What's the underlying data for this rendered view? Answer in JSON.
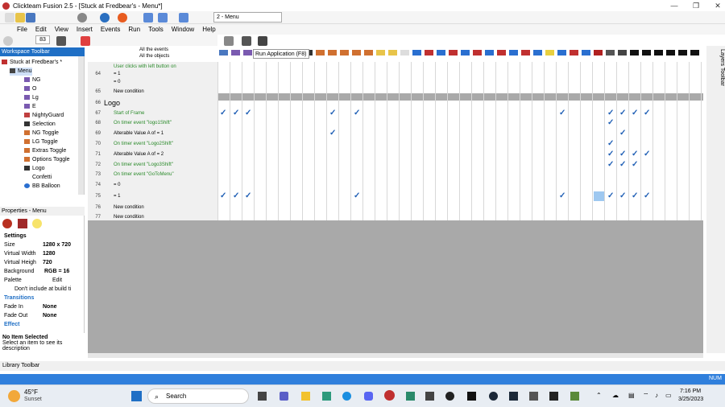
{
  "window": {
    "title": "Clickteam Fusion 2.5 - [Stuck at Fredbear's - Menu*]"
  },
  "toolbar": {
    "frame_select": "2 - Menu",
    "zoom": "83"
  },
  "menu": [
    "File",
    "Edit",
    "View",
    "Insert",
    "Events",
    "Run",
    "Tools",
    "Window",
    "Help"
  ],
  "tooltip": "Run Application (F8)",
  "workspace": {
    "header": "Workspace Toolbar",
    "items": [
      "Stuck at Fredbear's *",
      "Menu",
      "NG",
      "O",
      "Lg",
      "E",
      "NightyGuard",
      "Selection",
      "NG Toggle",
      "LG Toggle",
      "Extras Toggle",
      "Options Toggle",
      "Logo",
      "Confetti",
      "BB Balloon"
    ]
  },
  "properties": {
    "header": "Properties - Menu",
    "section_settings": "Settings",
    "size_label": "Size",
    "size_value": "1280 x 720",
    "vwidth_label": "Virtual Width",
    "vwidth_value": "1280",
    "vheight_label": "Virtual Heigh",
    "vheight_value": "720",
    "bg_label": "Background",
    "bg_value": "RGB = 16",
    "palette_label": "Palette",
    "palette_value": "Edit",
    "dont_include": "Don't include at build ti",
    "section_transitions": "Transitions",
    "fadein_label": "Fade In",
    "fadein_value": "None",
    "fadeout_label": "Fade Out",
    "fadeout_value": "None",
    "section_effect": "Effect"
  },
  "no_item": {
    "title": "No Item Selected",
    "text": "Select an item to see its description"
  },
  "library_bar": "Library Toolbar",
  "events_header": {
    "all_events": "All the events",
    "all_objects": "All the objects"
  },
  "events": [
    {
      "n": "",
      "text": "User clicks with left button on",
      "green": true
    },
    {
      "n": "64",
      "text": "= 1",
      "green": false
    },
    {
      "n": "",
      "text": "= 0",
      "green": false
    },
    {
      "n": "65",
      "text": "New condition",
      "green": false
    },
    {
      "n": "66",
      "text": "Logo",
      "green": false
    },
    {
      "n": "67",
      "text": "Start of Frame",
      "green": true
    },
    {
      "n": "68",
      "text": "On timer event \"logo1Shift\"",
      "green": true
    },
    {
      "n": "69",
      "text": "Alterable Value A of  = 1",
      "green": false
    },
    {
      "n": "70",
      "text": "On timer event \"Logo2Shift\"",
      "green": true
    },
    {
      "n": "71",
      "text": "Alterable Value A of  = 2",
      "green": false
    },
    {
      "n": "72",
      "text": "On timer event \"Logo3Shift\"",
      "green": true
    },
    {
      "n": "73",
      "text": "On timer event \"GoToMenu\"",
      "green": true
    },
    {
      "n": "74",
      "text": "= 0",
      "green": false
    },
    {
      "n": "75",
      "text": "= 1",
      "green": false
    },
    {
      "n": "76",
      "text": "New condition",
      "green": false
    },
    {
      "n": "77",
      "text": "New condition",
      "green": false
    }
  ],
  "right_panel": "Layers Toolbar",
  "status": {
    "num": "NUM"
  },
  "taskbar": {
    "weather_temp": "45°F",
    "weather_text": "Sunset",
    "search": "Search",
    "time": "7:16 PM",
    "date": "3/25/2023"
  },
  "colors": {
    "accent": "#1f6fc5",
    "status_bar": "#2f7fdc",
    "check": "#1f5fb5",
    "editor_bg": "#a9a9a9"
  }
}
